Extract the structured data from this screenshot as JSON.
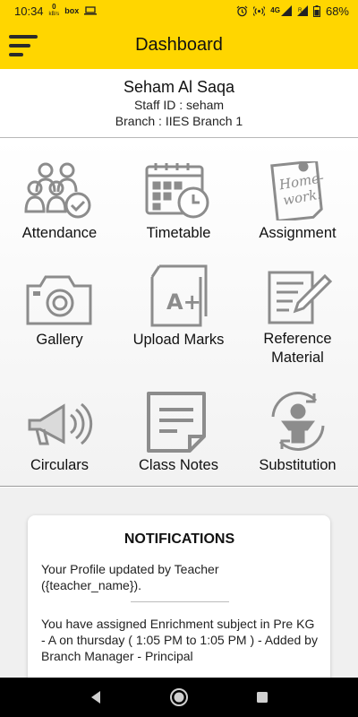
{
  "status_bar": {
    "time": "10:34",
    "speed_value": "0",
    "speed_unit": "kB/s",
    "box_label": "box",
    "network": "4G",
    "battery": "68%"
  },
  "app_bar": {
    "title": "Dashboard"
  },
  "profile": {
    "name": "Seham Al Saqa",
    "staff_id": "Staff ID : seham",
    "branch": "Branch : IIES Branch 1"
  },
  "tiles": [
    {
      "label": "Attendance",
      "icon": "attendance-icon"
    },
    {
      "label": "Timetable",
      "icon": "timetable-icon"
    },
    {
      "label": "Assignment",
      "icon": "homework-icon"
    },
    {
      "label": "Gallery",
      "icon": "camera-icon"
    },
    {
      "label": "Upload Marks",
      "icon": "grade-document-icon"
    },
    {
      "label": "Reference Material",
      "icon": "edit-document-icon"
    },
    {
      "label": "Circulars",
      "icon": "megaphone-icon"
    },
    {
      "label": "Class Notes",
      "icon": "notes-icon"
    },
    {
      "label": "Substitution",
      "icon": "substitution-icon"
    }
  ],
  "homework_sticker": [
    "Home-",
    "work!"
  ],
  "grade_glyph": "A+",
  "notifications": {
    "title": "NOTIFICATIONS",
    "items": [
      "Your Profile updated by Teacher ({teacher_name}).",
      "You have assigned Enrichment subject in Pre KG - A on thursday ( 1:05 PM to 1:05 PM ) - Added by Branch Manager - Principal"
    ]
  },
  "colors": {
    "accent": "#ffd600",
    "icon_gray": "#8c8c8c"
  }
}
